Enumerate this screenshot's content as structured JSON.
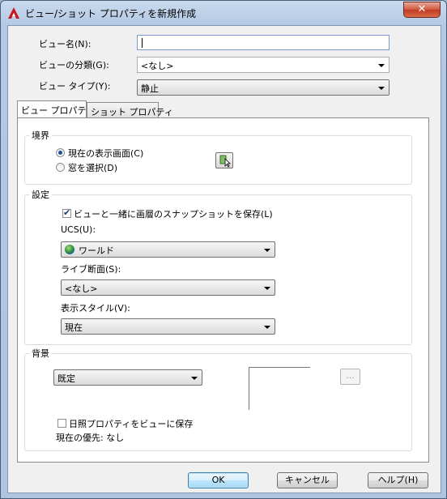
{
  "window": {
    "title": "ビュー/ショット プロパティを新規作成",
    "close_glyph": "✕"
  },
  "form": {
    "view_name_label": "ビュー名(N):",
    "view_name_value": "",
    "view_category_label": "ビューの分類(G):",
    "view_category_value": "<なし>",
    "view_type_label": "ビュー タイプ(Y):",
    "view_type_value": "静止"
  },
  "tabs": [
    {
      "label": "ビュー プロパティ",
      "active": true
    },
    {
      "label": "ショット プロパティ",
      "active": false
    }
  ],
  "boundary": {
    "title": "境界",
    "option_current": "現在の表示画面(C)",
    "option_window": "窓を選択(D)",
    "selected": "current"
  },
  "settings": {
    "title": "設定",
    "save_layer_snapshot_label": "ビューと一緒に画層のスナップショットを保存(L)",
    "save_layer_snapshot_checked": true,
    "ucs_label": "UCS(U):",
    "ucs_value": "ワールド",
    "live_section_label": "ライブ断面(S):",
    "live_section_value": "<なし>",
    "visual_style_label": "表示スタイル(V):",
    "visual_style_value": "現在"
  },
  "background": {
    "title": "背景",
    "type_value": "既定",
    "browse_label": "...",
    "save_sun_label": "日照プロパティをビューに保存",
    "save_sun_checked": false,
    "current_override": "現在の優先: なし"
  },
  "buttons": {
    "ok": "OK",
    "cancel": "キャンセル",
    "help": "ヘルプ(H)"
  },
  "colors": {
    "title_gradient_top": "#c9daee",
    "close_red": "#c03a22",
    "default_button_blue": "#3c7fb1"
  }
}
